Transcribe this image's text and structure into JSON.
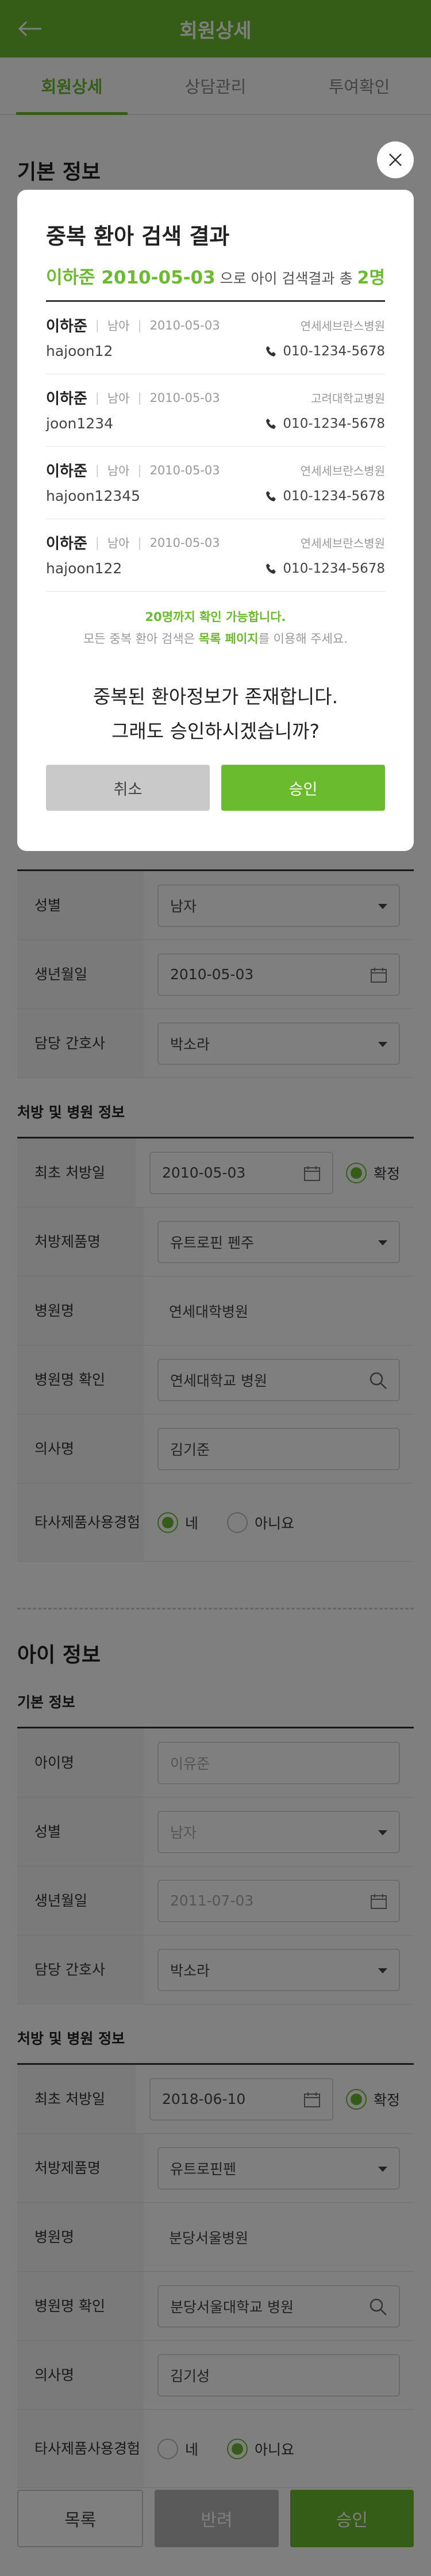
{
  "header": {
    "title": "회원상세"
  },
  "tabs": [
    {
      "label": "회원상세",
      "active": true
    },
    {
      "label": "상담관리",
      "active": false
    },
    {
      "label": "투여확인",
      "active": false
    }
  ],
  "section1": {
    "title": "기본 정보",
    "gender_label": "성별",
    "gender_value": "남자",
    "birth_label": "생년월일",
    "birth_value": "2010-05-03",
    "nurse_label": "담당 간호사",
    "nurse_value": "박소라",
    "rx_title": "처방 및 병원 정보",
    "first_rx_label": "최초 처방일",
    "first_rx_value": "2010-05-03",
    "confirm_label": "확정",
    "product_label": "처방제품명",
    "product_value": "유트로핀 펜주",
    "hospital_label": "병원명",
    "hospital_value": "연세대학병원",
    "hospital_check_label": "병원명 확인",
    "hospital_check_value": "연세대학교 병원",
    "doctor_label": "의사명",
    "doctor_value": "김기준",
    "other_label_1": "타사제품",
    "other_label_2": "사용경험",
    "yes_label": "네",
    "no_label": "아니요"
  },
  "child": {
    "title": "아이 정보",
    "basic_title": "기본 정보",
    "name_label": "아이명",
    "name_placeholder": "이유준",
    "gender_label": "성별",
    "gender_value": "남자",
    "birth_label": "생년월일",
    "birth_value": "2011-07-03",
    "nurse_label": "담당 간호사",
    "nurse_value": "박소라",
    "rx_title": "처방 및 병원 정보",
    "first_rx_label": "최초 처방일",
    "first_rx_value": "2018-06-10",
    "confirm_label": "확정",
    "product_label": "처방제품명",
    "product_value": "유트로핀펜",
    "hospital_label": "병원명",
    "hospital_value": "분당서울병원",
    "hospital_check_label": "병원명 확인",
    "hospital_check_value": "분당서울대학교 병원",
    "doctor_label": "의사명",
    "doctor_value": "김기성",
    "other_label_1": "타사제품",
    "other_label_2": "사용경험",
    "yes_label": "네",
    "no_label": "아니요"
  },
  "bottom": {
    "list": "목록",
    "reject": "반려",
    "approve": "승인"
  },
  "modal": {
    "title": "중복 환아 검색 결과",
    "search_name": "이하준 2010-05-03",
    "search_suffix": " 으로 아이 검색결과",
    "total_prefix": "총 ",
    "total_count": "2명",
    "results": [
      {
        "name": "이하준",
        "gender": "남아",
        "birth": "2010-05-03",
        "hospital": "연세세브란스병원",
        "id": "hajoon12",
        "phone": "010-1234-5678"
      },
      {
        "name": "이하준",
        "gender": "남아",
        "birth": "2010-05-03",
        "hospital": "고려대학교병원",
        "id": "joon1234",
        "phone": "010-1234-5678"
      },
      {
        "name": "이하준",
        "gender": "남아",
        "birth": "2010-05-03",
        "hospital": "연세세브란스병원",
        "id": "hajoon12345",
        "phone": "010-1234-5678"
      },
      {
        "name": "이하준",
        "gender": "남아",
        "birth": "2010-05-03",
        "hospital": "연세세브란스병원",
        "id": "hajoon122",
        "phone": "010-1234-5678"
      }
    ],
    "notice1": "20명까지 확인 가능합니다.",
    "notice2_a": "모든 중복 환아 검색은 ",
    "notice2_b": "목록 페이지",
    "notice2_c": "를 이용해 주세요.",
    "question1": "중복된 환아정보가 존재합니다.",
    "question2": "그래도 승인하시겠습니까?",
    "cancel": "취소",
    "approve": "승인"
  }
}
